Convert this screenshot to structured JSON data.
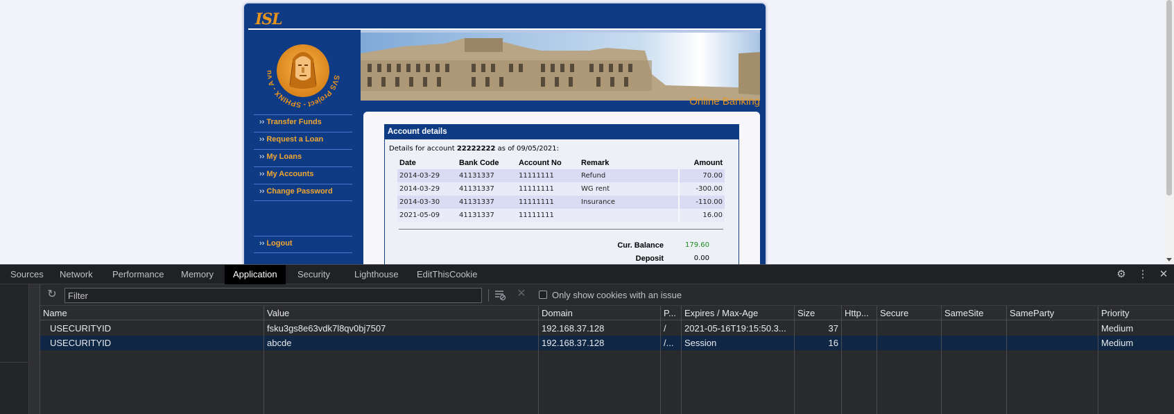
{
  "site": {
    "logo_text": "ISL",
    "banner_subtitle": "Online Banking",
    "sphinx_logo_text": "SVS Project - SPHINX - A vulnerable Web APP -",
    "nav": [
      {
        "label": "Transfer Funds"
      },
      {
        "label": "Request a Loan"
      },
      {
        "label": "My Loans"
      },
      {
        "label": "My Accounts"
      },
      {
        "label": "Change Password"
      }
    ],
    "logout_label": "Logout",
    "nav_arrow": "››"
  },
  "account": {
    "title": "Account details",
    "line_prefix": "Details for account",
    "account_number": "22222222",
    "line_mid": "as of",
    "date": "09/05/2021:",
    "columns": [
      "Date",
      "Bank Code",
      "Account No",
      "Remark",
      "Amount"
    ],
    "rows": [
      {
        "date": "2014-03-29",
        "bank": "41131337",
        "acct": "11111111",
        "remark": "Refund",
        "amount": "70.00",
        "sign": "pos"
      },
      {
        "date": "2014-03-29",
        "bank": "41131337",
        "acct": "11111111",
        "remark": "WG rent",
        "amount": "-300.00",
        "sign": "neg"
      },
      {
        "date": "2014-03-30",
        "bank": "41131337",
        "acct": "11111111",
        "remark": "Insurance",
        "amount": "-110.00",
        "sign": "neg"
      },
      {
        "date": "2021-05-09",
        "bank": "41131337",
        "acct": "11111111",
        "remark": "",
        "amount": "16.00",
        "sign": "pos"
      }
    ],
    "balance_label": "Cur. Balance",
    "balance_value": "179.60",
    "deposit_label": "Deposit",
    "deposit_value": "0.00"
  },
  "devtools": {
    "tabs": [
      "Sources",
      "Network",
      "Performance",
      "Memory",
      "Application",
      "Security",
      "Lighthouse",
      "EditThisCookie"
    ],
    "active_tab": "Application",
    "filter_placeholder": "Filter",
    "only_issues_label": "Only show cookies with an issue",
    "columns": [
      "Name",
      "Value",
      "Domain",
      "P...",
      "Expires / Max-Age",
      "Size",
      "Http...",
      "Secure",
      "SameSite",
      "SameParty",
      "Priority"
    ],
    "cookies": [
      {
        "name": "USECURITYID",
        "value": "fsku3gs8e63vdk7l8qv0bj7507",
        "domain": "192.168.37.128",
        "path": "/",
        "expires": "2021-05-16T19:15:50.3...",
        "size": "37",
        "http": "",
        "secure": "",
        "samesite": "",
        "sameparty": "",
        "priority": "Medium"
      },
      {
        "name": "USECURITYID",
        "value": "abcde",
        "domain": "192.168.37.128",
        "path": "/...",
        "expires": "Session",
        "size": "16",
        "http": "",
        "secure": "",
        "samesite": "",
        "sameparty": "",
        "priority": "Medium"
      }
    ]
  },
  "colors": {
    "site_blue": "#0f3b84",
    "accent_orange": "#e8951f",
    "positive": "#1b8a1b",
    "negative": "#c8202a",
    "devtools_bg": "#292a2d",
    "selected_row": "#0f2645"
  }
}
